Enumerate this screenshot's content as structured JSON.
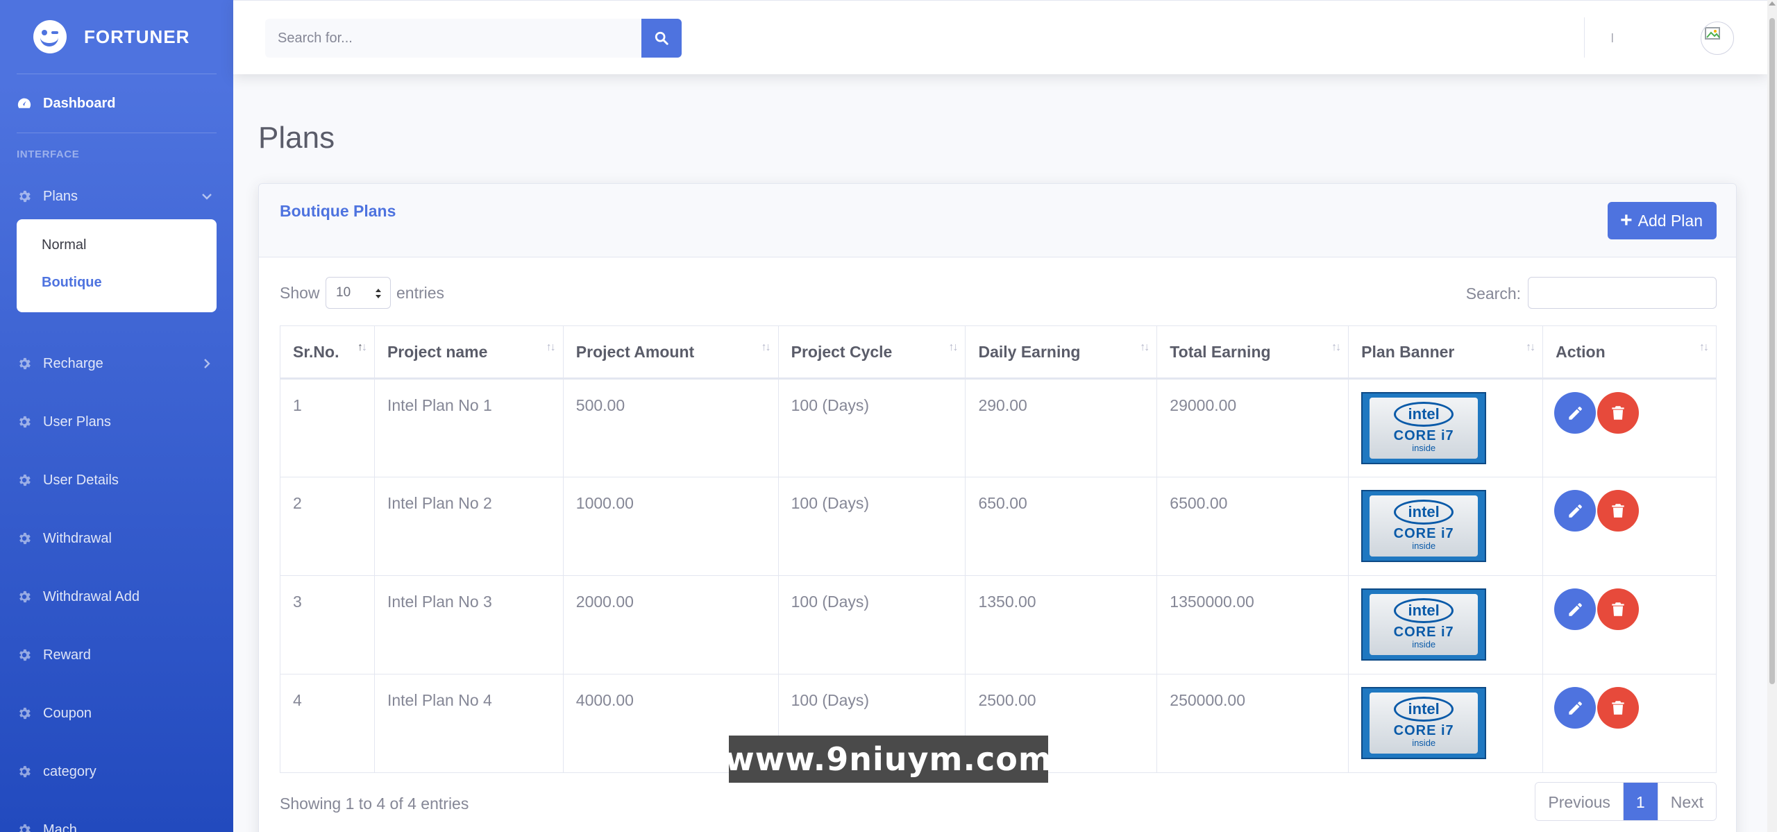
{
  "brand": {
    "name": "FORTUNER"
  },
  "sidebar": {
    "dashboard": "Dashboard",
    "section_heading": "INTERFACE",
    "plans": "Plans",
    "plans_sub": [
      "Normal",
      "Boutique"
    ],
    "recharge": "Recharge",
    "items": [
      "User Plans",
      "User Details",
      "Withdrawal",
      "Withdrawal Add",
      "Reward",
      "Coupon",
      "category",
      "Mach"
    ]
  },
  "topbar": {
    "search_placeholder": "Search for..."
  },
  "page": {
    "title": "Plans"
  },
  "card": {
    "title": "Boutique Plans",
    "add_button": "Add Plan"
  },
  "datatable": {
    "show": "Show",
    "length_value": "10",
    "entries": "entries",
    "search_label": "Search:",
    "columns": [
      "Sr.No.",
      "Project name",
      "Project Amount",
      "Project Cycle",
      "Daily Earning",
      "Total Earning",
      "Plan Banner",
      "Action"
    ],
    "rows": [
      [
        "1",
        "Intel Plan No 1",
        "500.00",
        "100 (Days)",
        "290.00",
        "29000.00"
      ],
      [
        "2",
        "Intel Plan No 2",
        "1000.00",
        "100 (Days)",
        "650.00",
        "6500.00"
      ],
      [
        "3",
        "Intel Plan No 3",
        "2000.00",
        "100 (Days)",
        "1350.00",
        "1350000.00"
      ],
      [
        "4",
        "Intel Plan No 4",
        "4000.00",
        "100 (Days)",
        "2500.00",
        "250000.00"
      ]
    ],
    "info": "Showing 1 to 4 of 4 entries",
    "pagination": {
      "previous": "Previous",
      "current": "1",
      "next": "Next"
    }
  },
  "banner": {
    "brand": "intel",
    "line": "CORE i7",
    "sub": "inside"
  },
  "watermark": "www.9niuym.com",
  "colors": {
    "primary": "#4e73df",
    "danger": "#e74a3b",
    "sidebar_dark": "#224abe"
  }
}
